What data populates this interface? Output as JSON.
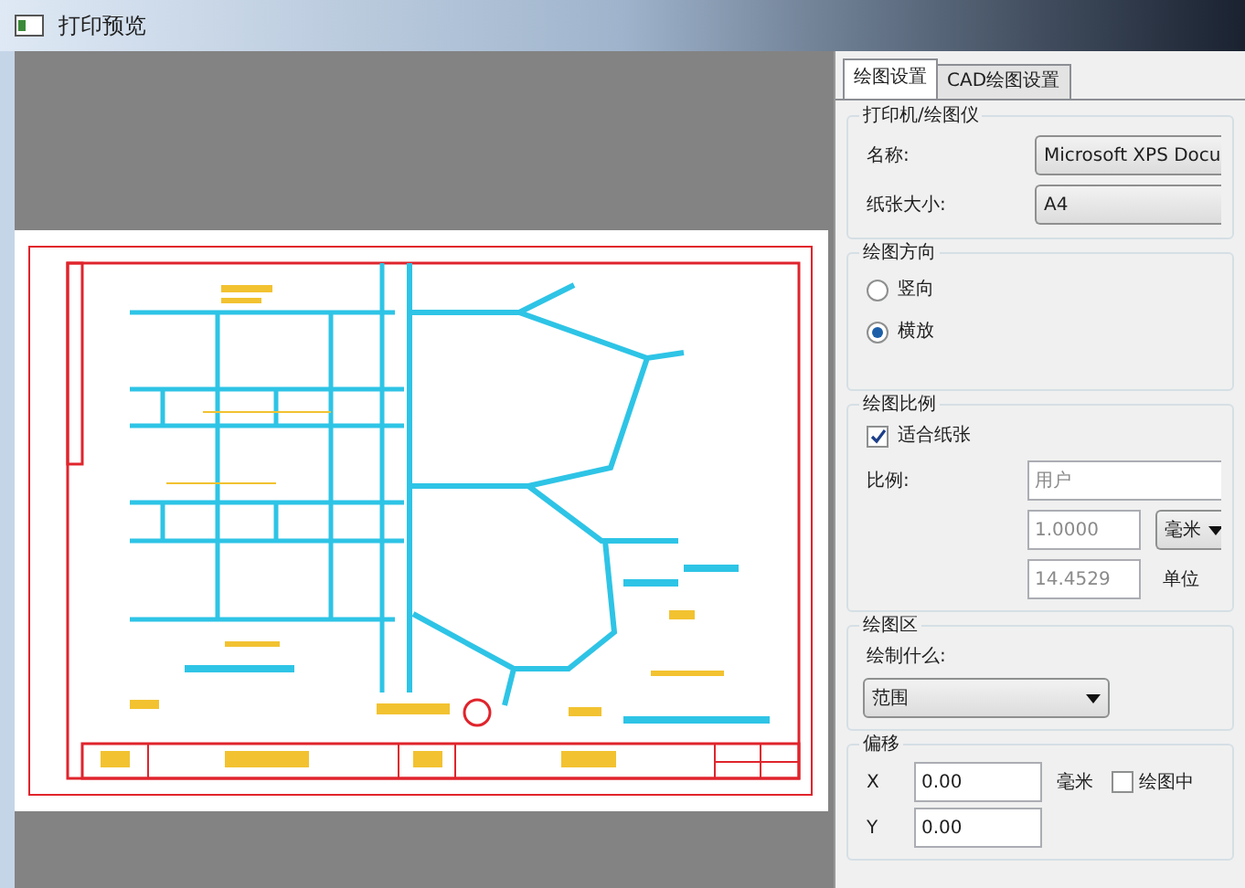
{
  "window": {
    "title": "打印预览"
  },
  "tabs": [
    {
      "label": "绘图设置",
      "selected": true
    },
    {
      "label": "CAD绘图设置",
      "selected": false
    }
  ],
  "printer": {
    "title": "打印机/绘图仪",
    "name_label": "名称:",
    "name_value": "Microsoft XPS Docu",
    "paper_label": "纸张大小:",
    "paper_value": "A4"
  },
  "orientation": {
    "title": "绘图方向",
    "options": [
      {
        "label": "竖向",
        "selected": false
      },
      {
        "label": "横放",
        "selected": true
      }
    ]
  },
  "scale": {
    "title": "绘图比例",
    "fit": {
      "label": "适合纸张",
      "checked": true
    },
    "ratio_label": "比例:",
    "ratio_value": "用户",
    "value_1": "1.0000",
    "unit_1": "毫米",
    "value_2": "14.4529",
    "unit_2": "单位"
  },
  "area": {
    "title": "绘图区",
    "what_label": "绘制什么:",
    "what_value": "范围"
  },
  "offset": {
    "title": "偏移",
    "x_label": "X",
    "x_value": "0.00",
    "unit": "毫米",
    "center": {
      "label": "绘图中",
      "checked": false
    },
    "y_label": "Y",
    "y_value": "0.00"
  }
}
